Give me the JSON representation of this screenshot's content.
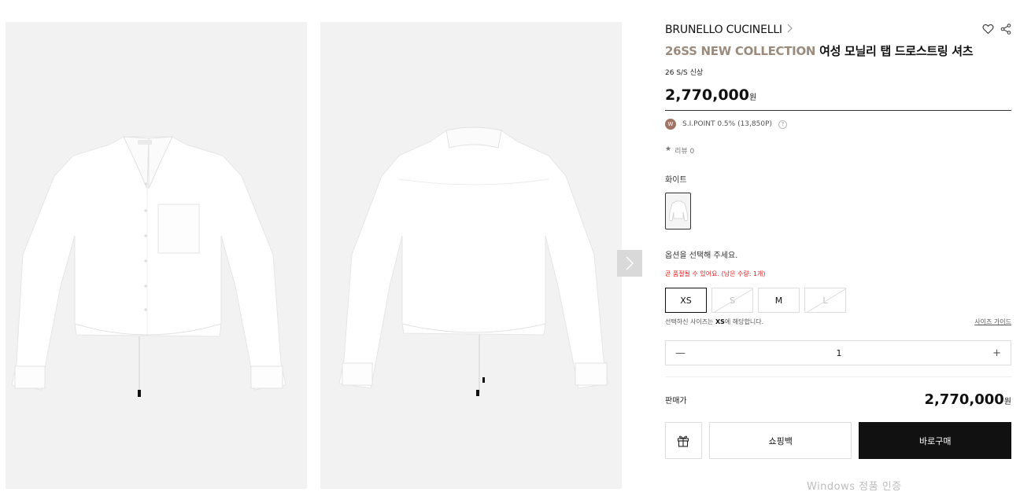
{
  "product": {
    "brand": "BRUNELLO CUCINELLI",
    "title_collection": "26SS NEW COLLECTION",
    "title_name": "여성 모닐리 탭 드로스트링 셔츠",
    "season_tags": "26 S/S  신상",
    "price": "2,770,000",
    "currency": "원",
    "point_badge": "W",
    "point_text": "S.I.POINT 0.5% (13,850P)",
    "help": "?",
    "review_star": "★",
    "review_text": "리뷰 0"
  },
  "color": {
    "label": "화이트"
  },
  "options": {
    "prompt": "옵션을 선택해 주세요.",
    "stock_warning": "곧 품절될 수 있어요. (남은 수량: 1개)",
    "sizes": [
      {
        "label": "XS",
        "state": "selected"
      },
      {
        "label": "S",
        "state": "soldout"
      },
      {
        "label": "M",
        "state": "available"
      },
      {
        "label": "L",
        "state": "soldout"
      }
    ],
    "size_note_pre": "선택하신 사이즈는 ",
    "size_note_value": "XS",
    "size_note_post": "에 해당합니다.",
    "size_guide": "사이즈 가이드"
  },
  "quantity": {
    "minus": "—",
    "value": "1",
    "plus": "+"
  },
  "summary": {
    "label": "판매가",
    "price": "2,770,000",
    "currency": "원"
  },
  "buttons": {
    "cart": "쇼핑백",
    "buy": "바로구매"
  },
  "icons": {
    "brand_chevron": "chevron-right-icon",
    "wishlist": "heart-icon",
    "share": "share-icon",
    "next": "chevron-right-icon",
    "gift": "gift-icon"
  },
  "watermark": "Windows 정품 인증",
  "colors": {
    "accent_collection": "#9b8b7d",
    "point_badge": "#a07565",
    "warning": "#dd2222",
    "buy_button": "#111111"
  }
}
